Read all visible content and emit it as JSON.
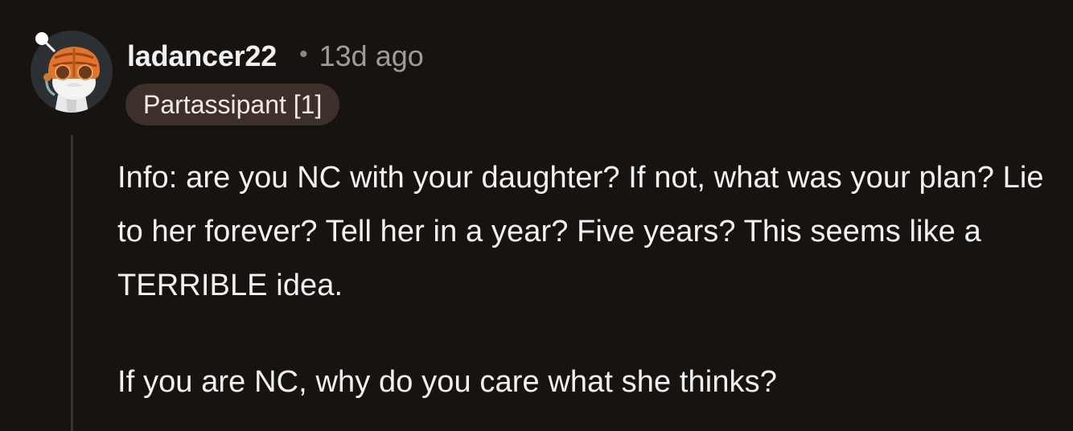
{
  "comment": {
    "author": {
      "username": "ladancer22",
      "avatar_icon": "snoo-avatar-icon"
    },
    "separator": "•",
    "timestamp": "13d ago",
    "flair": "Partassipant [1]",
    "body": {
      "paragraph_1": "Info: are you NC with your daughter? If not, what was your plan? Lie to her forever? Tell her in a year? Five years? This seems like a TERRIBLE idea.",
      "paragraph_2": "If you are NC, why do you care what she thinks?"
    }
  },
  "colors": {
    "background": "#171311",
    "text": "#f2f2f2",
    "muted": "#a39a94",
    "flair_background": "#3d2f29",
    "thread_line": "#3a3532"
  }
}
